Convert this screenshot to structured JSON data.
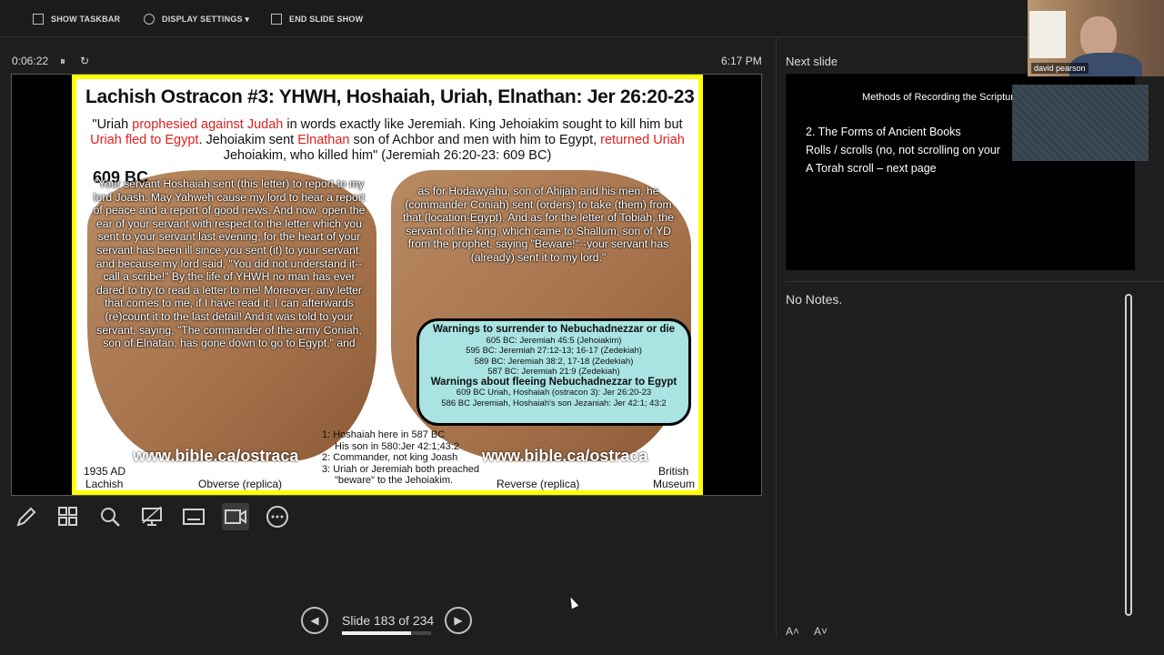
{
  "toolbar": {
    "show_taskbar": "SHOW TASKBAR",
    "display_settings": "DISPLAY SETTINGS ▾",
    "end_slide_show": "END SLIDE SHOW"
  },
  "status": {
    "timer": "0:06:22",
    "clock": "6:17 PM"
  },
  "slide": {
    "title": "Lachish Ostracon #3: YHWH, Hoshaiah, Uriah, Elnathan: Jer 26:20-23",
    "quote_1": "\"Uriah ",
    "quote_red_1": "prophesied against Judah",
    "quote_2": " in words exactly like Jeremiah. King Jehoiakim sought to kill him but ",
    "quote_red_2": "Uriah fled to Egypt",
    "quote_3": ". Jehoiakim sent ",
    "quote_red_3": "Elnathan",
    "quote_4": " son of Achbor and men with him to Egypt, ",
    "quote_red_4": "returned Uriah",
    "quote_5": " Jehoiakim, who killed him\" (Jeremiah 26:20-23: 609 BC)",
    "year": "609 BC",
    "obverse_text": "\"Your servant Hoshaiah sent (this letter) to report to my lord Joash: May Yahweh cause my lord to hear a report of peace and a report of good news. And now, open the ear of your servant with respect to the letter which you sent to your servant last evening, for the heart of your servant has been ill since you sent (it) to your servant. and because my lord said, \"You did not understand it-- call a scribe!\" By the life of YHWH no man has ever dared to try to read a letter to me! Moreover, any letter that comes to me, if I have read it, I can afterwards (re)count it to the last detail! And it was told to your servant, saying, \"The commander of the army Coniah, son of Elnatan, has gone down to go to Egypt,\" and",
    "reverse_text": "as for Hodawyahu, son of Ahijah and his men, he (commander Coniah) sent (orders) to take (them) from that (location-Egypt). And as for the letter of Tobiah, the servant of the king, which came to Shallum, son of YD from the prophet, saying \"Beware!\"--your servant has (already) sent it to my lord.\"",
    "box_heading_1": "Warnings to surrender to Nebuchadnezzar or die",
    "box_items_1": [
      "605 BC: Jeremiah 45:5 (Jehoiakim)",
      "595 BC: Jeremiah 27:12-13; 16-17 (Zedekiah)",
      "589 BC: Jeremiah 38:2, 17-18 (Zedekiah)",
      "587 BC: Jeremiah 21:9 (Zedekiah)"
    ],
    "box_heading_2": "Warnings about fleeing Nebuchadnezzar to Egypt",
    "box_items_2": [
      "609 BC Uriah, Hoshaiah (ostracon 3): Jer 26:20-23",
      "586 BC Jeremiah, Hoshaiah's son Jezaniah: Jer 42:1; 43:2"
    ],
    "url_left": "www.bible.ca/ostraca",
    "url_right": "www.bible.ca/ostraca",
    "cap_left_1": "1935 AD",
    "cap_left_2": "Lachish",
    "cap_obverse": "Obverse (replica)",
    "cap_reverse": "Reverse (replica)",
    "cap_right_1": "British",
    "cap_right_2": "Museum",
    "notes": [
      "1: Hoshaiah here in 587 BC",
      "His son in 580:Jer 42:1;43:2",
      "2: Commander, not king Joash",
      "3: Uriah or Jeremiah both preached",
      "\"beware\" to the Jehoiakim."
    ]
  },
  "nav": {
    "slide_count": "Slide 183 of 234",
    "progress": 0.78
  },
  "next": {
    "label": "Next slide",
    "title": "Methods of Recording the Scriptur",
    "line_1": "2.    The Forms of Ancient Books",
    "line_2": " Rolls / scrolls (no, not scrolling on your",
    "line_3": "A Torah scroll – next page"
  },
  "notes_panel": {
    "text": "No Notes."
  },
  "webcam": {
    "name": "david pearson"
  },
  "colors": {
    "slide_border": "#ffff00",
    "highlight_red": "#e02020",
    "highlight_yellow": "#ffff40",
    "callout_bg": "#a9e3e2"
  }
}
